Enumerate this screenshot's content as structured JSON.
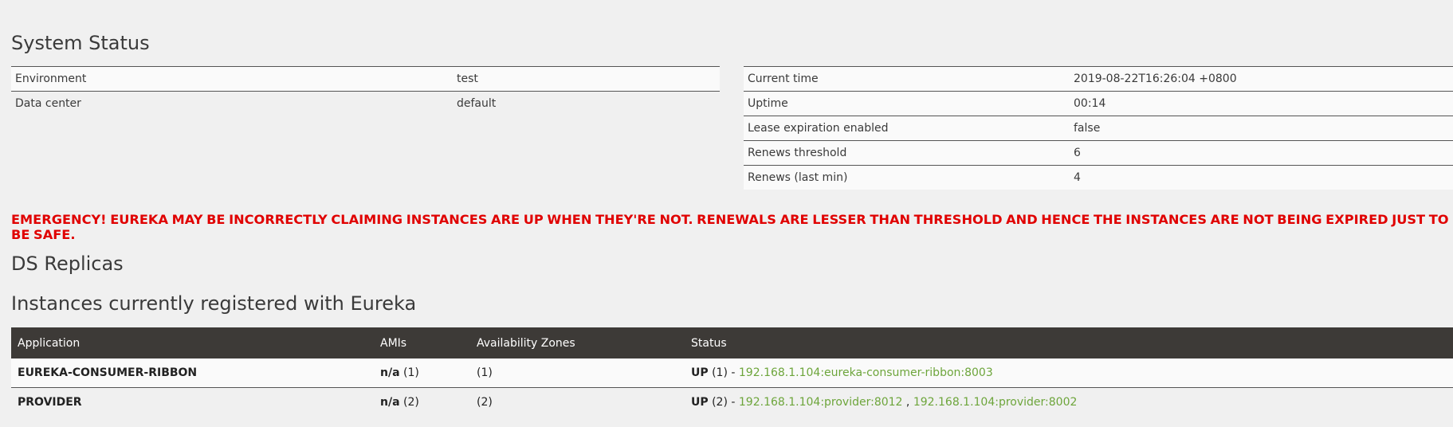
{
  "system_status": {
    "title": "System Status",
    "left": [
      {
        "label": "Environment",
        "value": "test"
      },
      {
        "label": "Data center",
        "value": "default"
      }
    ],
    "right": [
      {
        "label": "Current time",
        "value": "2019-08-22T16:26:04 +0800"
      },
      {
        "label": "Uptime",
        "value": "00:14"
      },
      {
        "label": "Lease expiration enabled",
        "value": "false"
      },
      {
        "label": "Renews threshold",
        "value": "6"
      },
      {
        "label": "Renews (last min)",
        "value": "4"
      }
    ]
  },
  "emergency": "EMERGENCY! EUREKA MAY BE INCORRECTLY CLAIMING INSTANCES ARE UP WHEN THEY'RE NOT. RENEWALS ARE LESSER THAN THRESHOLD AND HENCE THE INSTANCES ARE NOT BEING EXPIRED JUST TO BE SAFE.",
  "ds_replicas": {
    "title": "DS Replicas"
  },
  "instances": {
    "title": "Instances currently registered with Eureka",
    "headers": [
      "Application",
      "AMIs",
      "Availability Zones",
      "Status"
    ],
    "rows": [
      {
        "application": "EUREKA-CONSUMER-RIBBON",
        "ami": "n/a",
        "ami_count": "(1)",
        "zones": "(1)",
        "status": "UP",
        "status_count": "(1) -",
        "links": [
          "192.168.1.104:eureka-consumer-ribbon:8003"
        ]
      },
      {
        "application": "PROVIDER",
        "ami": "n/a",
        "ami_count": "(2)",
        "zones": "(2)",
        "status": "UP",
        "status_count": "(2) -",
        "links": [
          "192.168.1.104:provider:8012",
          "192.168.1.104:provider:8002"
        ],
        "separator": ","
      }
    ]
  },
  "colors": {
    "emergency": "#e00000",
    "link": "#6da53b",
    "header_bg": "#3d3a37"
  }
}
